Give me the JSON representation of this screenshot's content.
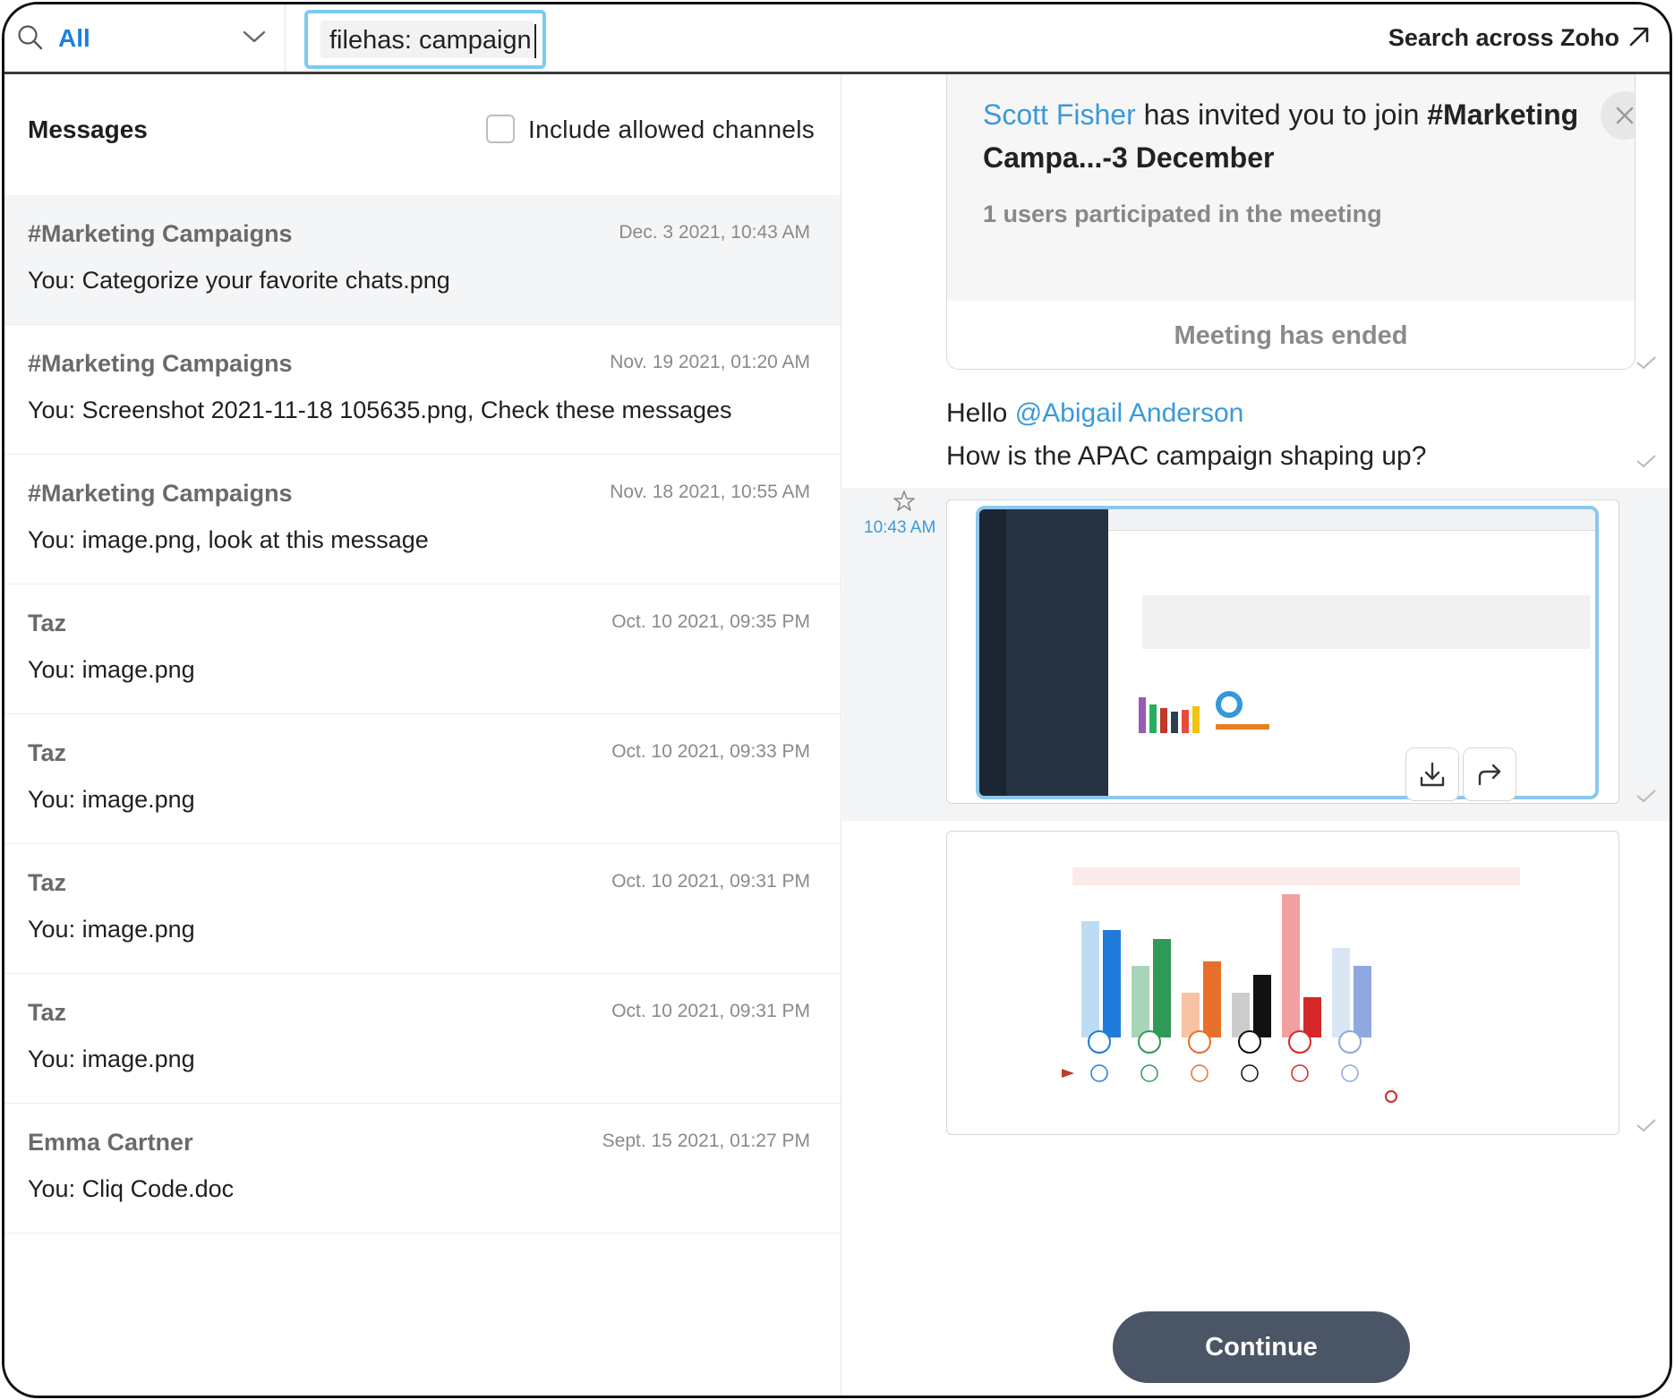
{
  "search": {
    "scope_label": "All",
    "query": "filehas: campaign",
    "across_label": "Search across Zoho"
  },
  "left": {
    "title": "Messages",
    "include_label": "Include allowed channels",
    "results": [
      {
        "title": "#Marketing Campaigns",
        "time": "Dec. 3 2021, 10:43 AM",
        "message": "You:  Categorize your favorite chats.png",
        "active": true
      },
      {
        "title": "#Marketing Campaigns",
        "time": "Nov. 19 2021, 01:20 AM",
        "message": "You:  Screenshot 2021-11-18 105635.png, Check these messages",
        "active": false
      },
      {
        "title": "#Marketing Campaigns",
        "time": "Nov. 18 2021, 10:55 AM",
        "message": "You:  image.png, look at this message",
        "active": false
      },
      {
        "title": "Taz",
        "time": "Oct. 10 2021, 09:35 PM",
        "message": "You:  image.png",
        "active": false
      },
      {
        "title": "Taz",
        "time": "Oct. 10 2021, 09:33 PM",
        "message": "You:  image.png",
        "active": false
      },
      {
        "title": "Taz",
        "time": "Oct. 10 2021, 09:31 PM",
        "message": "You:  image.png",
        "active": false
      },
      {
        "title": "Taz",
        "time": "Oct. 10 2021, 09:31 PM",
        "message": "You:  image.png",
        "active": false
      },
      {
        "title": "Emma  Cartner",
        "time": "Sept. 15 2021, 01:27 PM",
        "message": "You:  Cliq Code.doc",
        "active": false
      }
    ]
  },
  "chat": {
    "meeting": {
      "inviter": "Scott Fisher",
      "invite_text": " has invited you to join ",
      "channel": "#Marketing",
      "channel_rest": "Campa...-3 December",
      "participants": "1 users participated in the meeting",
      "ended": "Meeting has ended"
    },
    "hello": "Hello ",
    "mention": "@Abigail Anderson",
    "question": "How is the APAC campaign shaping up?",
    "message_time": "10:43 AM",
    "continue_label": "Continue"
  },
  "colors": {
    "accent": "#1b7fe0",
    "link": "#3a9ad9",
    "focus_ring": "#7ccaf2",
    "continue_bg": "#4a5565"
  }
}
